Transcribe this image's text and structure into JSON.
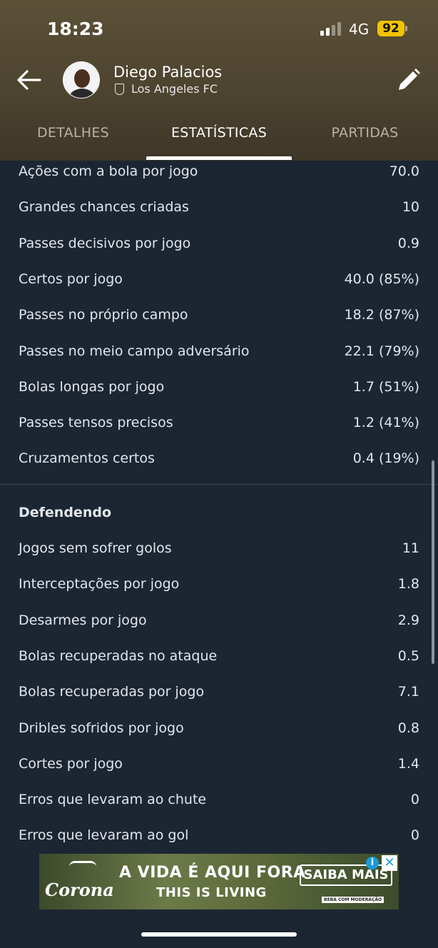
{
  "status_bar": {
    "time": "18:23",
    "network": "4G",
    "battery": "92"
  },
  "header": {
    "player_name": "Diego Palacios",
    "club": "Los Angeles FC"
  },
  "tabs": [
    {
      "label": "DETALHES",
      "active": false
    },
    {
      "label": "ESTATÍSTICAS",
      "active": true
    },
    {
      "label": "PARTIDAS",
      "active": false
    }
  ],
  "passing_stats": [
    {
      "label": "Ações com a bola por jogo",
      "value": "70.0"
    },
    {
      "label": "Grandes chances criadas",
      "value": "10"
    },
    {
      "label": "Passes decisivos por jogo",
      "value": "0.9"
    },
    {
      "label": "Certos por jogo",
      "value": "40.0 (85%)"
    },
    {
      "label": "Passes no próprio campo",
      "value": "18.2 (87%)"
    },
    {
      "label": "Passes no meio campo adversário",
      "value": "22.1 (79%)"
    },
    {
      "label": "Bolas longas por jogo",
      "value": "1.7 (51%)"
    },
    {
      "label": "Passes tensos precisos",
      "value": "1.2 (41%)"
    },
    {
      "label": "Cruzamentos certos",
      "value": "0.4 (19%)"
    }
  ],
  "defending": {
    "title": "Defendendo",
    "stats": [
      {
        "label": "Jogos sem sofrer golos",
        "value": "11"
      },
      {
        "label": "Interceptações por jogo",
        "value": "1.8"
      },
      {
        "label": "Desarmes por jogo",
        "value": "2.9"
      },
      {
        "label": "Bolas recuperadas no ataque",
        "value": "0.5"
      },
      {
        "label": "Bolas recuperadas por jogo",
        "value": "7.1"
      },
      {
        "label": "Dribles sofridos por jogo",
        "value": "0.8"
      },
      {
        "label": "Cortes por jogo",
        "value": "1.4"
      },
      {
        "label": "Erros que levaram ao chute",
        "value": "0"
      },
      {
        "label": "Erros que levaram ao gol",
        "value": "0"
      }
    ]
  },
  "ad": {
    "brand": "Corona",
    "headline": "A VIDA É AQUI FORA",
    "subline": "THIS IS LIVING",
    "cta": "SAIBA MAIS",
    "disclaimer": "BEBA COM MODERAÇÃO",
    "info_icon": "i",
    "close_icon": "✕"
  },
  "colors": {
    "background": "#1c2633",
    "header": "#4d4430",
    "battery": "#f2c300",
    "text": "#e3e6eb"
  }
}
